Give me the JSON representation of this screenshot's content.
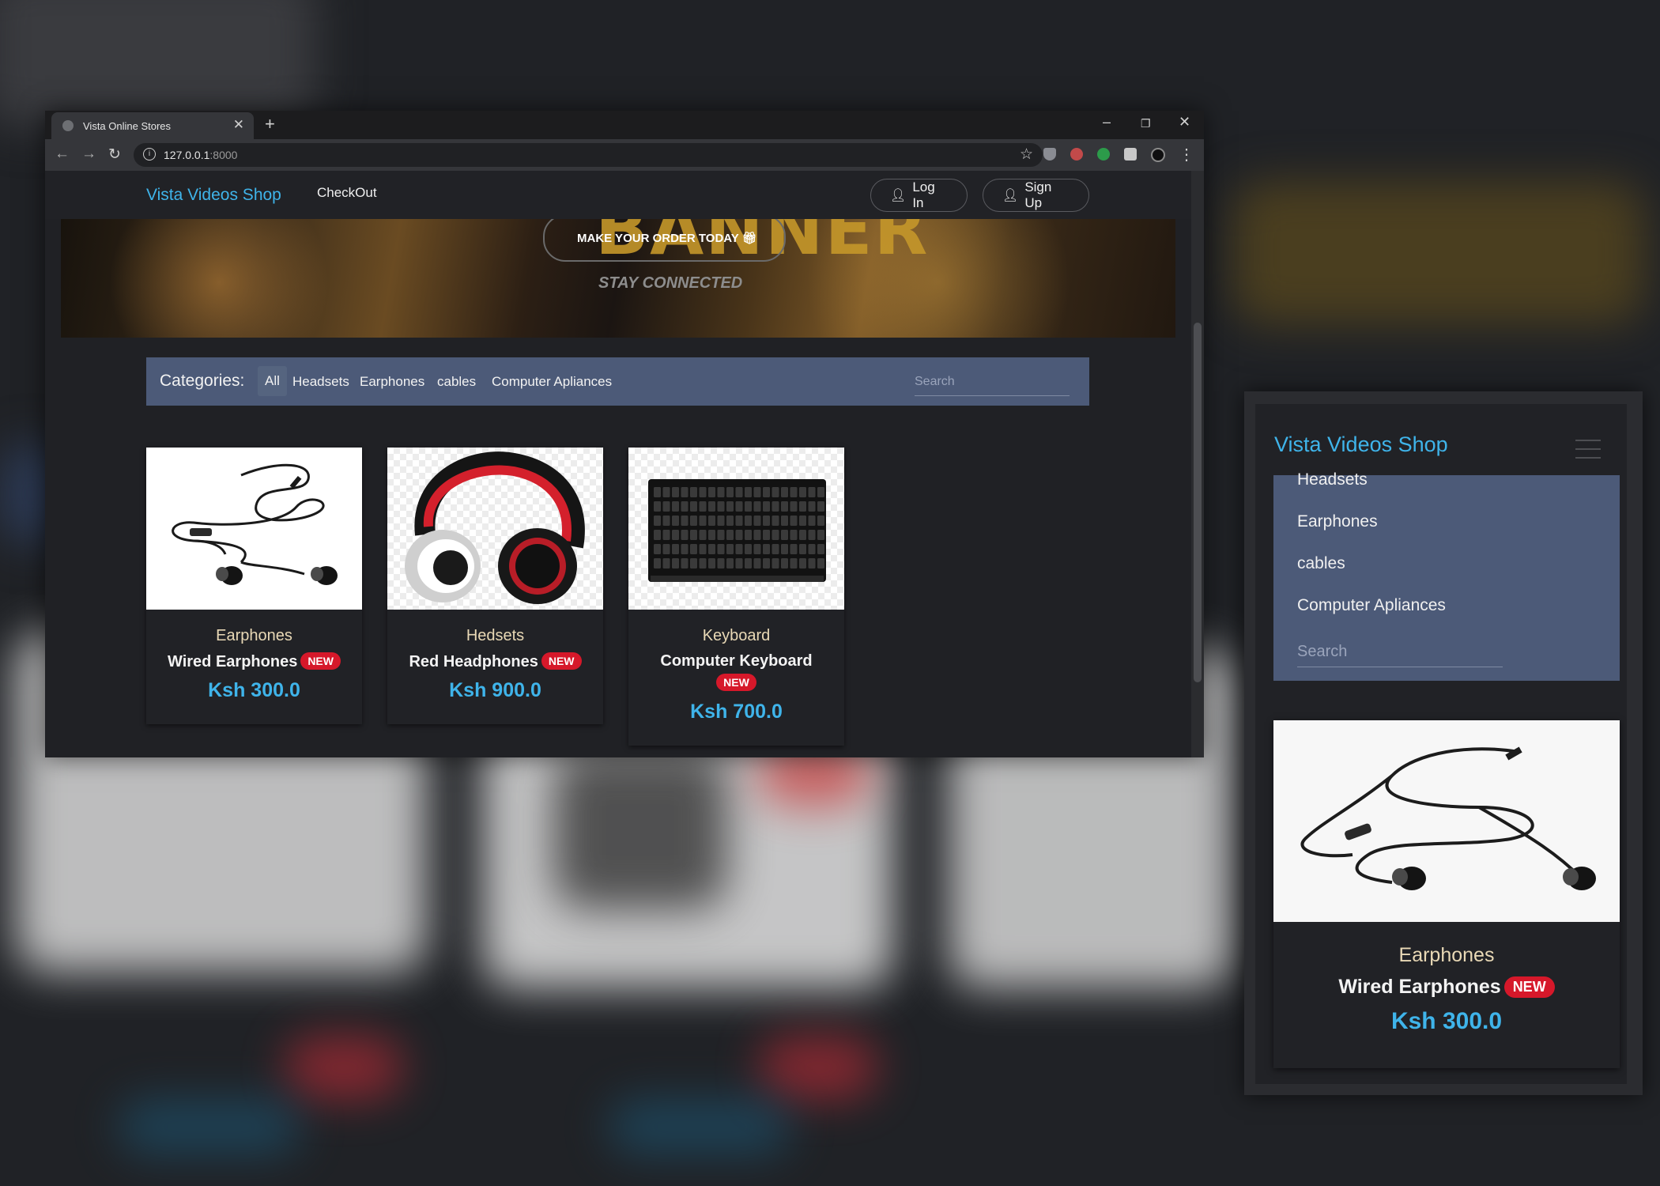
{
  "browser": {
    "tab_title": "Vista Online Stores",
    "url_host": "127.0.0.1",
    "url_port": ":8000"
  },
  "navbar": {
    "brand": "Vista Videos Shop",
    "checkout": "CheckOut",
    "login": "Log In",
    "signup": "Sign Up"
  },
  "banner": {
    "cta": "MAKE YOUR ORDER TODAY",
    "big_text": "BANNER",
    "tagline": "STAY CONNECTED"
  },
  "categories": {
    "label": "Categories:",
    "items": [
      "All",
      "Headsets",
      "Earphones",
      "cables",
      "Computer Apliances"
    ],
    "active": "All",
    "search_placeholder": "Search"
  },
  "products": [
    {
      "category": "Earphones",
      "name": "Wired Earphones",
      "badge": "NEW",
      "price": "Ksh 300.0",
      "icon": "earphones"
    },
    {
      "category": "Hedsets",
      "name": "Red Headphones",
      "badge": "NEW",
      "price": "Ksh 900.0",
      "icon": "headphones"
    },
    {
      "category": "Keyboard",
      "name": "Computer Keyboard",
      "badge": "NEW",
      "price": "Ksh 700.0",
      "icon": "keyboard"
    }
  ],
  "mobile": {
    "brand": "Vista Videos Shop",
    "menu_items": [
      "Headsets",
      "Earphones",
      "cables",
      "Computer Apliances"
    ],
    "search_placeholder": "Search",
    "product": {
      "category": "Earphones",
      "name": "Wired Earphones",
      "badge": "NEW",
      "price": "Ksh 300.0"
    }
  },
  "colors": {
    "accent": "#3fb4ea",
    "category_bar": "#4c5a78",
    "badge": "#d6182a",
    "page_bg": "#202125"
  }
}
